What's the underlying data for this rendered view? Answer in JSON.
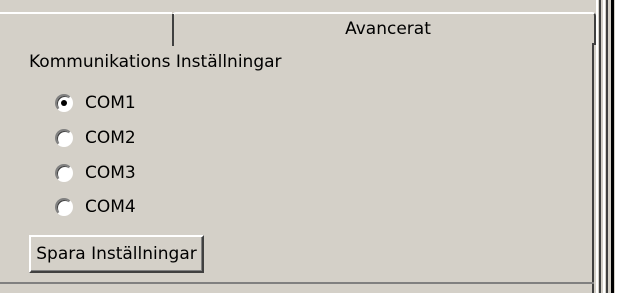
{
  "tabs": [
    {
      "label": ""
    },
    {
      "label": "Avancerat"
    }
  ],
  "group": {
    "title": "Kommunikations Inställningar"
  },
  "ports": [
    {
      "label": "COM1",
      "checked": true
    },
    {
      "label": "COM2",
      "checked": false
    },
    {
      "label": "COM3",
      "checked": false
    },
    {
      "label": "COM4",
      "checked": false
    }
  ],
  "save_button": {
    "label": "Spara Inställningar"
  },
  "colors": {
    "face": "#d4d0c8",
    "highlight": "#ffffff",
    "shadow": "#808080",
    "dark_shadow": "#404040"
  }
}
